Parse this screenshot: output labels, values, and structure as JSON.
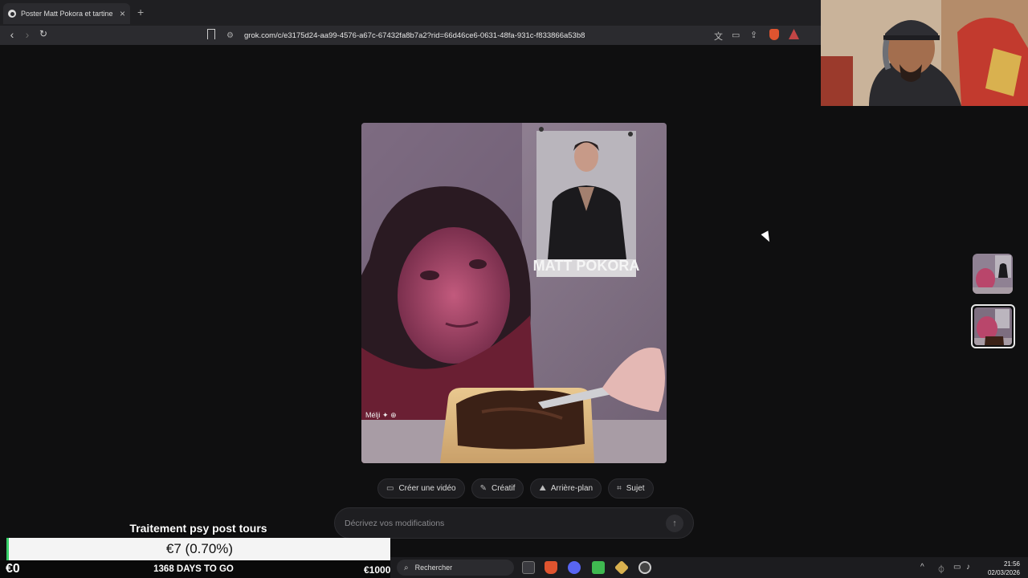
{
  "browser": {
    "tab_title": "Poster Matt Pokora et tartine ch",
    "new_tab": "+",
    "tab_close": "×",
    "url": "grok.com/c/e3175d24-aa99-4576-a67c-67432fa8b7a2?rid=66d46ce6-0631-48fa-931c-f833866a53b8"
  },
  "image": {
    "poster_text": "MATT POKORA",
    "watermark": "Mélji"
  },
  "actions": [
    {
      "icon": "video-camera-icon",
      "label": "Créer une vidéo"
    },
    {
      "icon": "brush-icon",
      "label": "Créatif"
    },
    {
      "icon": "mountain-icon",
      "label": "Arrière-plan"
    },
    {
      "icon": "focus-icon",
      "label": "Sujet"
    }
  ],
  "prompt": {
    "placeholder": "Décrivez vos modifications"
  },
  "stream_overlay": {
    "goal_title": "Traitement psy post tours",
    "goal_progress": "€7 (0.70%)",
    "goal_progress_fraction": 0.007,
    "goal_min": "€0",
    "goal_days": "1368 DAYS TO GO",
    "goal_max": "€1000"
  },
  "taskbar": {
    "search_label": "Rechercher",
    "time": "21:56",
    "date": "02/03/2026"
  },
  "colors": {
    "page_bg": "#0f0f10",
    "goal_bar": "#f4f4f4",
    "goal_accent": "#39d16a"
  }
}
